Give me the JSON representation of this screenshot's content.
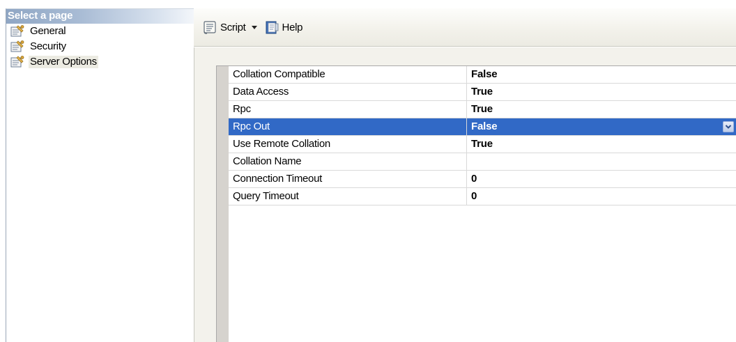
{
  "left_pane": {
    "header": "Select a page",
    "items": [
      {
        "label": "General",
        "icon": "page-wrench-icon",
        "selected": false
      },
      {
        "label": "Security",
        "icon": "page-wrench-icon",
        "selected": false
      },
      {
        "label": "Server Options",
        "icon": "page-wrench-icon",
        "selected": true
      }
    ]
  },
  "toolbar": {
    "script_label": "Script",
    "script_icon": "script-scroll-icon",
    "help_label": "Help",
    "help_icon": "help-book-icon"
  },
  "properties": [
    {
      "name": "Collation Compatible",
      "value": "False"
    },
    {
      "name": "Data Access",
      "value": "True"
    },
    {
      "name": "Rpc",
      "value": "True"
    },
    {
      "name": "Rpc Out",
      "value": "False",
      "selected": true
    },
    {
      "name": "Use Remote Collation",
      "value": "True"
    },
    {
      "name": "Collation Name",
      "value": ""
    },
    {
      "name": "Connection Timeout",
      "value": "0"
    },
    {
      "name": "Query Timeout",
      "value": "0"
    }
  ],
  "colors": {
    "selection": "#3169c6",
    "header_gradient": "#8fa6c4",
    "gutter": "#d6d3ce"
  }
}
